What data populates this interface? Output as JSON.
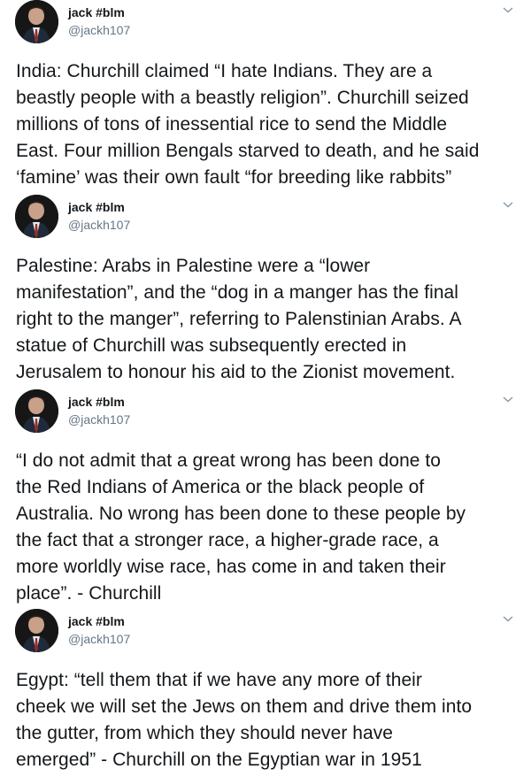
{
  "tweets": [
    {
      "author_name": "jack #blm",
      "author_handle": "@jackh107",
      "avatar_icon": "profile-photo",
      "menu_icon": "chevron-down-icon",
      "text": "India: Churchill claimed “I hate Indians. They are a\nbeastly people with a beastly religion”. Churchill seized\nmillions of tons of inessential rice to send the Middle\nEast. Four million Bengals starved to death, and he said\n‘famine’ was their own fault “for breeding like rabbits”"
    },
    {
      "author_name": "jack #blm",
      "author_handle": "@jackh107",
      "avatar_icon": "profile-photo",
      "menu_icon": "chevron-down-icon",
      "text": "Palestine: Arabs in Palestine were a “lower\nmanifestation”, and the “dog in a manger has the final\nright to the manger”, referring to Palenstinian Arabs. A\nstatue of Churchill was subsequently erected in\nJerusalem to honour his aid to the Zionist movement."
    },
    {
      "author_name": "jack #blm",
      "author_handle": "@jackh107",
      "avatar_icon": "profile-photo",
      "menu_icon": "chevron-down-icon",
      "text": "“I do not admit that a great wrong has been done to\nthe Red Indians of America or the black people of\nAustralia. No wrong has been done to these people by\nthe fact that a stronger race, a higher-grade race, a\nmore worldly wise race, has come in and taken their\nplace”. - Churchill"
    },
    {
      "author_name": "jack #blm",
      "author_handle": "@jackh107",
      "avatar_icon": "profile-photo",
      "menu_icon": "chevron-down-icon",
      "text": "Egypt: “tell them that if we have any more of their\ncheek we will set the Jews on them and drive them into\nthe gutter, from which they should never have\nemerged” - Churchill on the Egyptian war in 1951"
    }
  ],
  "colors": {
    "text_primary": "#14171a",
    "text_secondary": "#657786",
    "background": "#ffffff",
    "chevron": "#8899a6"
  }
}
